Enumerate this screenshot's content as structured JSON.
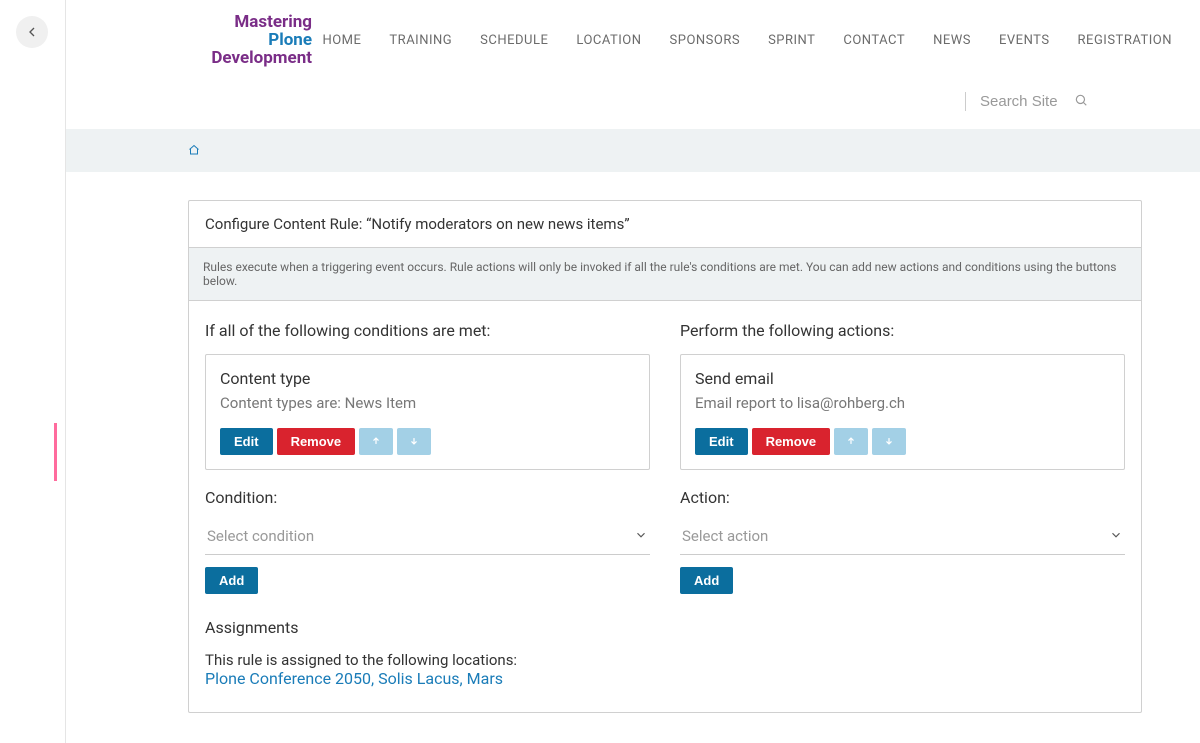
{
  "logo": {
    "line1": "Mastering",
    "line2": "Plone",
    "line3": "Development"
  },
  "nav": {
    "items": [
      "HOME",
      "TRAINING",
      "SCHEDULE",
      "LOCATION",
      "SPONSORS",
      "SPRINT",
      "CONTACT",
      "NEWS",
      "EVENTS",
      "REGISTRATION"
    ]
  },
  "search": {
    "placeholder": "Search Site"
  },
  "panel": {
    "title": "Configure Content Rule: “Notify moderators on new news items”",
    "help": "Rules execute when a triggering event occurs. Rule actions will only be invoked if all the rule's conditions are met. You can add new actions and conditions using the buttons below."
  },
  "conditions": {
    "heading": "If all of the following conditions are met:",
    "card_title": "Content type",
    "card_desc": "Content types are: News Item",
    "edit": "Edit",
    "remove": "Remove",
    "label": "Condition:",
    "select_placeholder": "Select condition",
    "add": "Add"
  },
  "actions": {
    "heading": "Perform the following actions:",
    "card_title": "Send email",
    "card_desc": "Email report to lisa@rohberg.ch",
    "edit": "Edit",
    "remove": "Remove",
    "label": "Action:",
    "select_placeholder": "Select action",
    "add": "Add"
  },
  "assignments": {
    "title": "Assignments",
    "intro": "This rule is assigned to the following locations:",
    "link_text": "Plone Conference 2050, Solis Lacus, Mars"
  }
}
